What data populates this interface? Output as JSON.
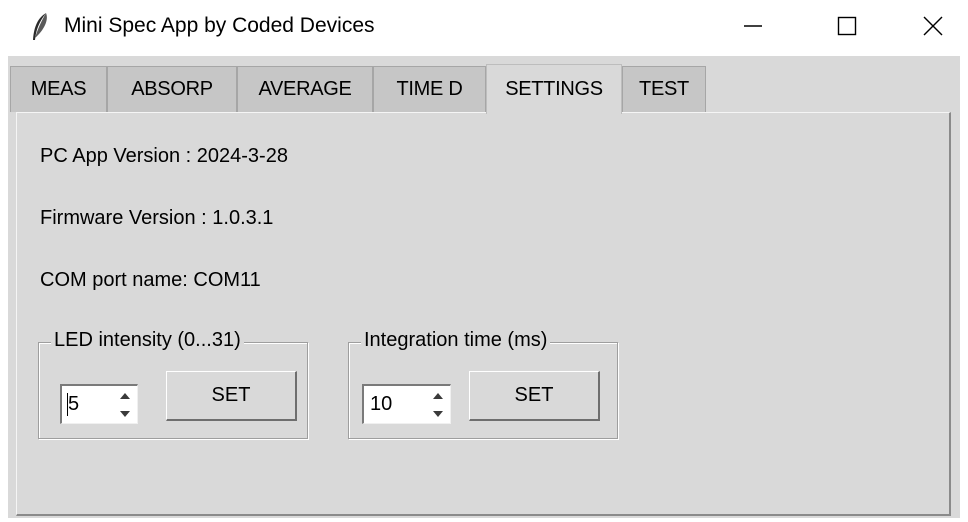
{
  "window": {
    "title": "Mini Spec App by Coded Devices",
    "app_icon": "feather-icon",
    "controls": [
      "minimize-icon",
      "maximize-icon",
      "close-icon"
    ]
  },
  "tabs": [
    {
      "label": "MEAS",
      "active": false
    },
    {
      "label": "ABSORP",
      "active": false
    },
    {
      "label": "AVERAGE",
      "active": false
    },
    {
      "label": "TIME D",
      "active": false
    },
    {
      "label": "SETTINGS",
      "active": true
    },
    {
      "label": "TEST",
      "active": false
    }
  ],
  "settings": {
    "pc_app_version": "PC App Version : 2024-3-28",
    "firmware_version": "Firmware Version : 1.0.3.1",
    "com_port": "COM port name: COM11",
    "led": {
      "legend": "LED intensity (0...31)",
      "value": "5",
      "button_label": "SET"
    },
    "integration": {
      "legend": "Integration time (ms)",
      "value": "10",
      "button_label": "SET"
    }
  }
}
